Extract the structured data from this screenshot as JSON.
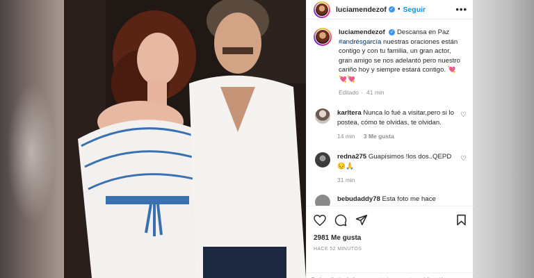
{
  "post": {
    "username": "luciamendezof",
    "follow_label": "Seguir",
    "more_label": "•••"
  },
  "caption": {
    "username": "luciamendezof",
    "text_before_tag": "Descansa en Paz",
    "hashtag": "#andrésgarcía",
    "text_after_tag": "nuestras oraciones están contigo y con tu familia, un gran actor, gran amigo se nos adelantó pero nuestro cariño hoy y siempre estará contigo. 💘💘💘",
    "edited": "Editado",
    "time": "41 min"
  },
  "comments": [
    {
      "username": "karltera",
      "text": "Nunca lo fué a visitar,pero si lo postea, cómo te olvidas, te olvidan.",
      "time": "14 min",
      "likes": "3 Me gusta",
      "avatar_color": "#c9c3bd"
    },
    {
      "username": "redna275",
      "text": "Guapísimos !los dos..QEPD😔🙏",
      "time": "31 min",
      "avatar_color": "#4a4a4a"
    },
    {
      "username": "bebudaddy78",
      "text": "Esta foto me hace",
      "avatar_color": "#8a8a8a"
    }
  ],
  "actions": {
    "likes": "2981 Me gusta",
    "posted_ago": "HACE 52 MINUTOS"
  },
  "footer": {
    "note": "Se han limitado los comentarios en esta publicación"
  },
  "colors": {
    "link": "#0095f6",
    "verified": "#3897f0",
    "muted": "#8e8e8e"
  }
}
